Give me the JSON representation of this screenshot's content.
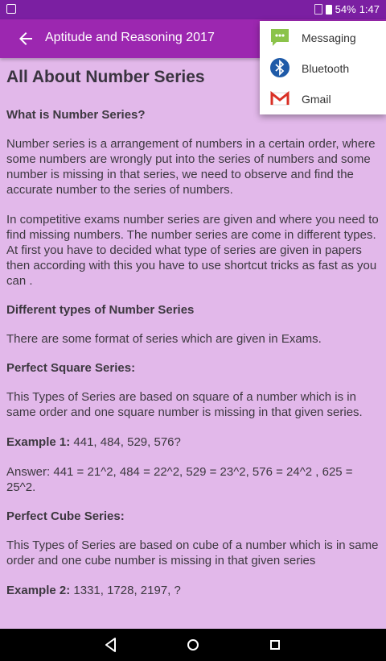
{
  "status_bar": {
    "battery": "54%",
    "time": "1:47"
  },
  "app_bar": {
    "title": "Aptitude and Reasoning 2017"
  },
  "article": {
    "heading": "All About Number Series",
    "q1": "What is Number Series?",
    "p1": "Number series is a arrangement of numbers in a certain order, where some numbers are wrongly put into the series of numbers and some number is missing in that series, we need to observe and find the accurate number to the series of numbers.",
    "p2": "In competitive exams number series are given and where you need to find missing numbers. The number series are come in different types. At first you have to decided what type of series are given in papers then according with this you have to use shortcut tricks as fast as you can .",
    "h2": "Different types of Number Series",
    "p3": "There are some format of series which are given in Exams.",
    "h3": "Perfect Square Series:",
    "p4": "This Types of Series are based on square of a number which is in same order and one square number is missing in that given series.",
    "ex1_label": "Example 1:",
    "ex1_text": " 441, 484, 529, 576?",
    "ans1": "Answer: 441 = 21^2, 484 = 22^2, 529 = 23^2, 576 = 24^2 , 625 = 25^2.",
    "h4": "Perfect Cube Series:",
    "p5": "This Types of Series are based on cube of a number which is in same order and one cube number is missing in that given series",
    "ex2_label": "Example 2:",
    "ex2_text": " 1331, 1728, 2197, ?"
  },
  "share_menu": {
    "items": [
      {
        "label": "Messaging",
        "icon": "messaging-icon"
      },
      {
        "label": "Bluetooth",
        "icon": "bluetooth-icon"
      },
      {
        "label": "Gmail",
        "icon": "gmail-icon"
      }
    ]
  },
  "colors": {
    "appbar": "#9c27b0",
    "statusbar": "#7b1fa2",
    "background": "#e2b8ea"
  }
}
